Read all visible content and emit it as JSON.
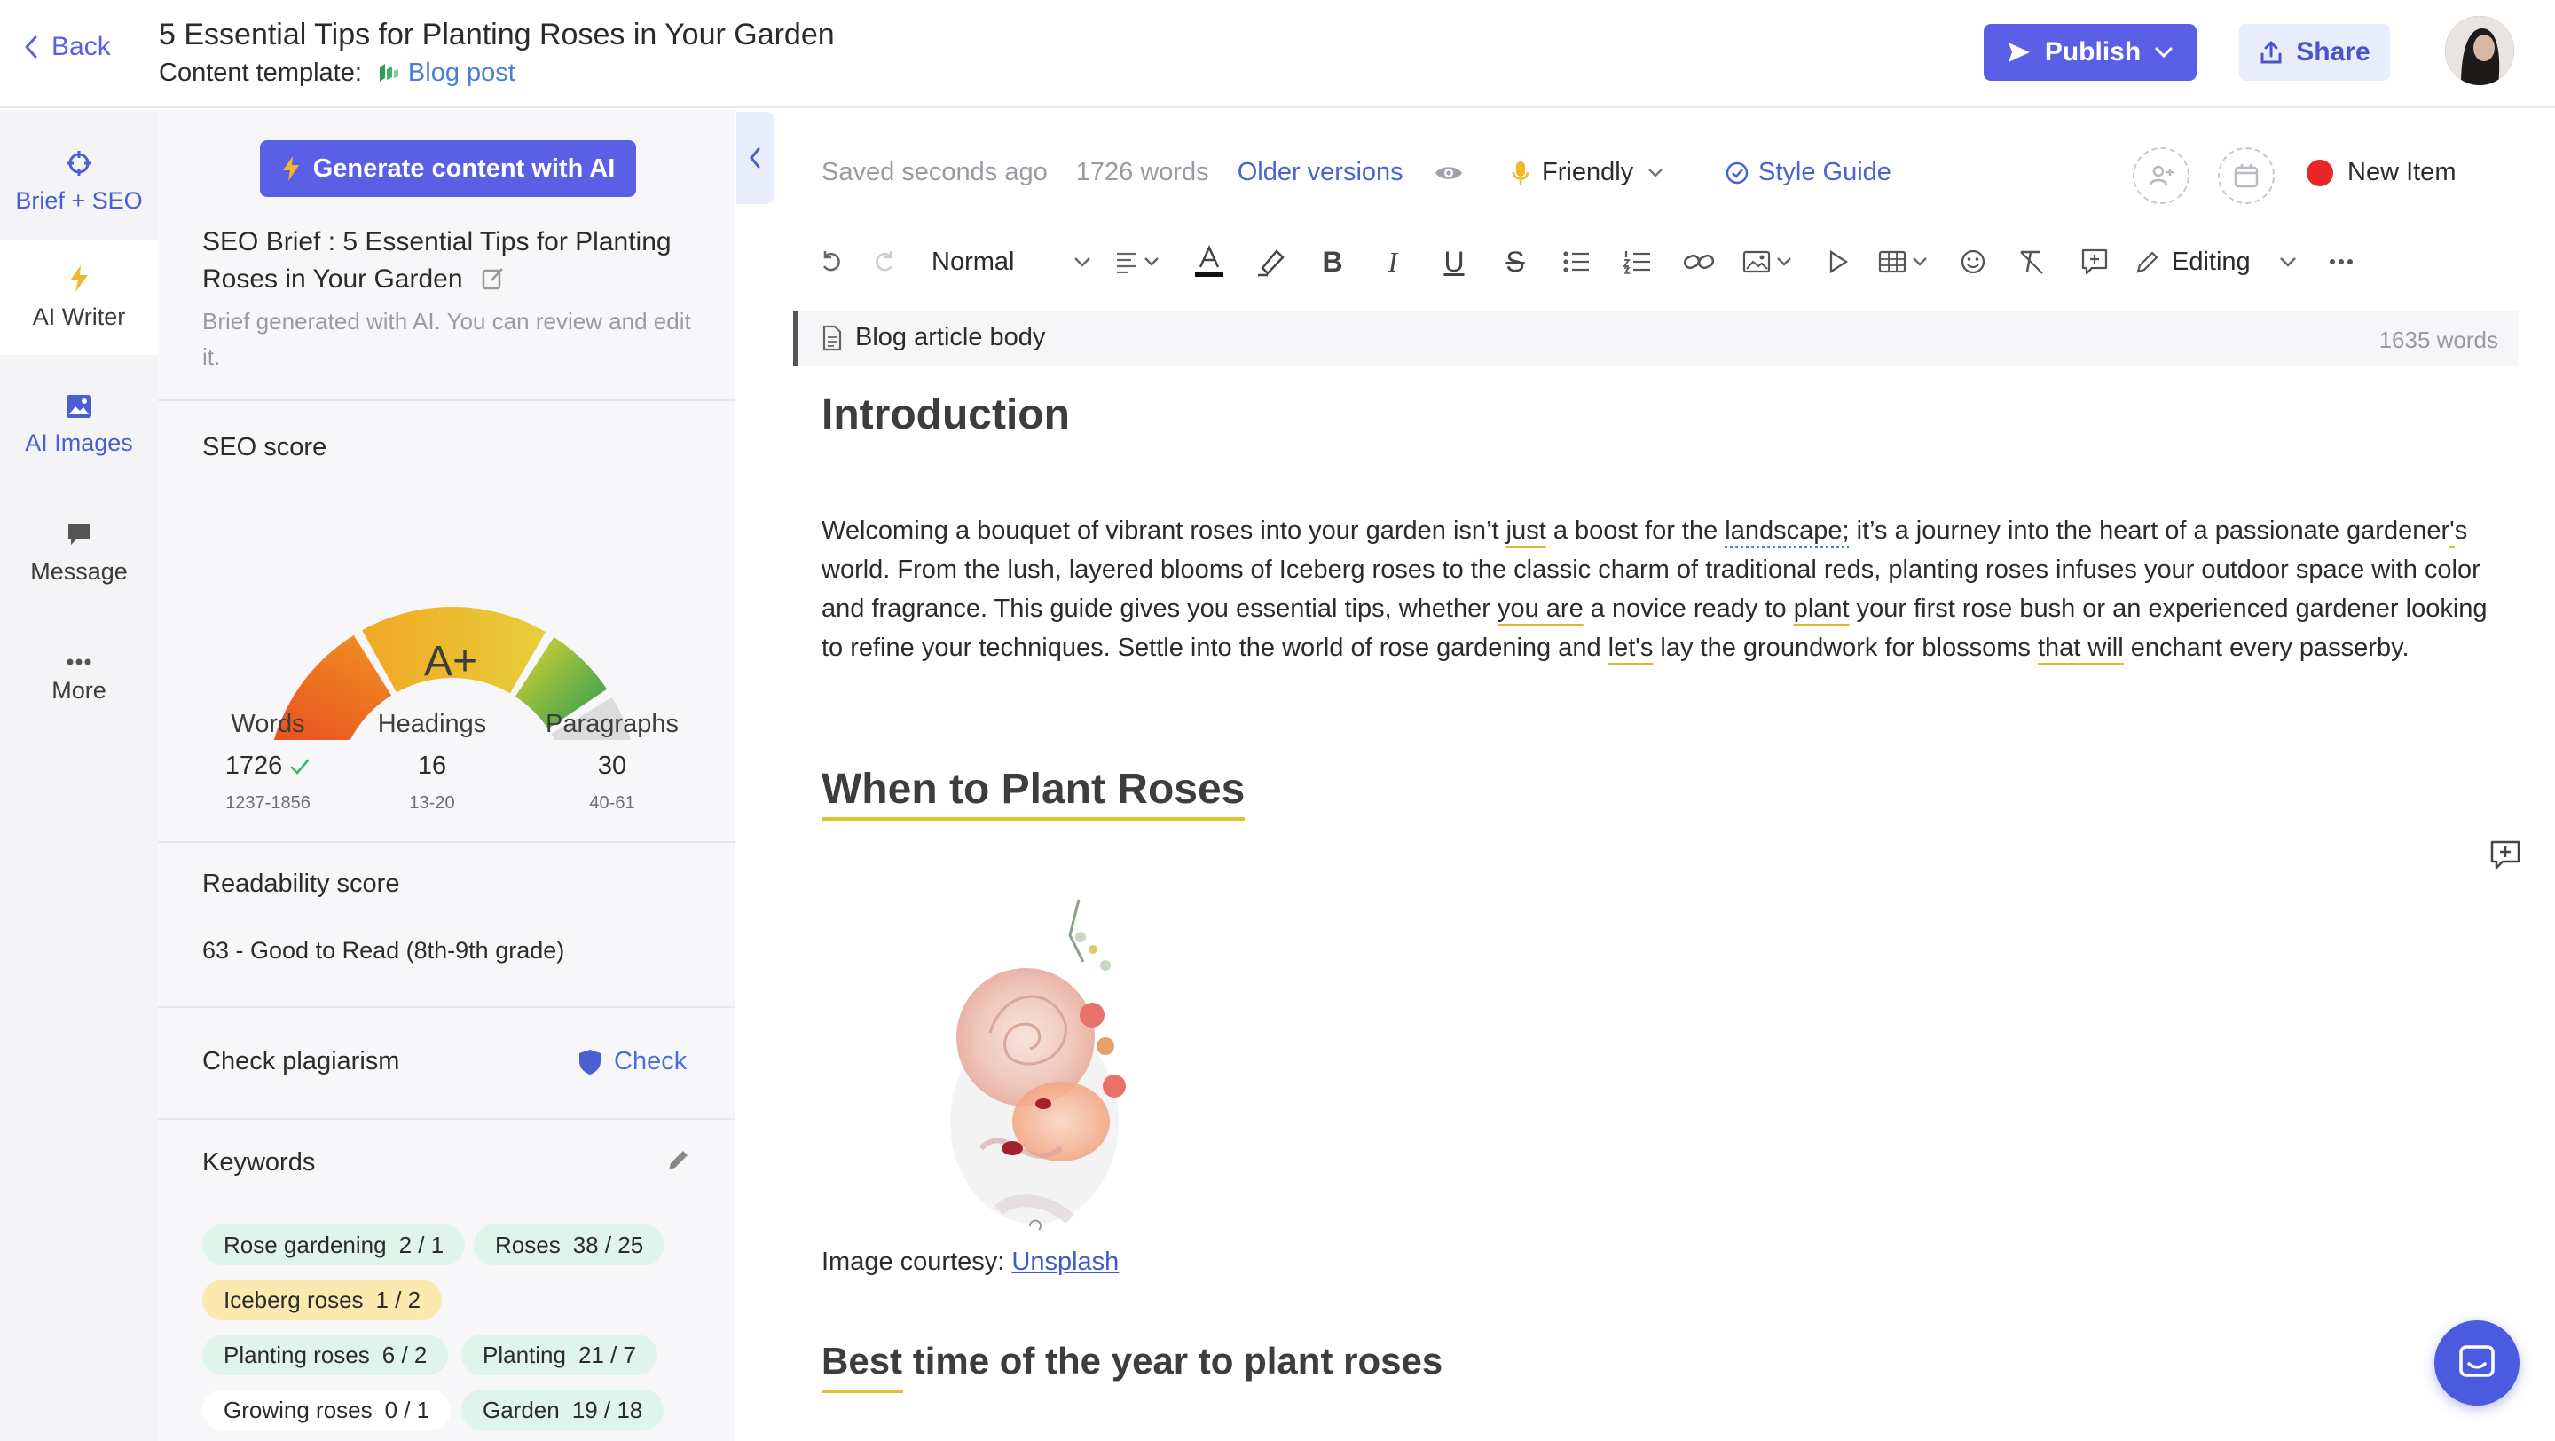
{
  "header": {
    "back_label": "Back",
    "title": "5 Essential Tips for Planting Roses in Your Garden",
    "template_label": "Content template:",
    "template_value": "Blog post",
    "publish_label": "Publish",
    "share_label": "Share"
  },
  "rail": {
    "items": [
      {
        "label": "Brief + SEO",
        "icon": "crosshair-icon"
      },
      {
        "label": "AI Writer",
        "icon": "lightning-icon"
      },
      {
        "label": "AI Images",
        "icon": "image-icon"
      },
      {
        "label": "Message",
        "icon": "chat-bubble-icon"
      },
      {
        "label": "More",
        "icon": "ellipsis-icon"
      }
    ]
  },
  "panel": {
    "generate_label": "Generate content with AI",
    "brief_title": "SEO Brief : 5 Essential Tips for Planting Roses in Your Garden",
    "brief_sub": "Brief generated with AI. You can review and edit it.",
    "seo_score_label": "SEO score",
    "grade": "A+",
    "stats": [
      {
        "label": "Words",
        "value": "1726",
        "range": "1237-1856",
        "ok": true
      },
      {
        "label": "Headings",
        "value": "16",
        "range": "13-20"
      },
      {
        "label": "Paragraphs",
        "value": "30",
        "range": "40-61"
      }
    ],
    "readability_label": "Readability score",
    "readability_value": "63 - Good to Read (8th-9th grade)",
    "plagiarism_label": "Check plagiarism",
    "check_label": "Check",
    "keywords_label": "Keywords",
    "keywords": [
      {
        "name": "Rose gardening",
        "count": "2 / 1",
        "color": "green"
      },
      {
        "name": "Roses",
        "count": "38 / 25",
        "color": "green"
      },
      {
        "name": "Iceberg roses",
        "count": "1 / 2",
        "color": "yellow"
      },
      {
        "name": "Planting roses",
        "count": "6 / 2",
        "color": "green"
      },
      {
        "name": "Planting",
        "count": "21 / 7",
        "color": "green"
      },
      {
        "name": "Growing roses",
        "count": "0 / 1",
        "color": "white"
      },
      {
        "name": "Garden",
        "count": "19 / 18",
        "color": "green"
      }
    ]
  },
  "editor": {
    "saved": "Saved seconds ago",
    "words": "1726 words",
    "older_versions": "Older versions",
    "tone": "Friendly",
    "style_guide": "Style Guide",
    "new_item": "New Item",
    "paragraph_style": "Normal",
    "mode": "Editing",
    "block_label": "Blog article body",
    "block_words": "1635 words",
    "h_intro": "Introduction",
    "intro_p1": "Welcoming a bouquet of vibrant roses into your garden isn’t ",
    "intro_just": "just",
    "intro_p2": " a boost for the ",
    "intro_landscape": "landscape;",
    "intro_p3": " it’s a journey into the heart of a passionate gardener",
    "intro_apos": "'",
    "intro_p4": "s world. From the lush, layered blooms of Iceberg roses to the classic charm of traditional reds, planting roses infuses your outdoor space with color and fragrance. This guide gives you essential tips, whether ",
    "intro_youare": "you are",
    "intro_p5": " a novice ready to ",
    "intro_plant": "plant",
    "intro_p6": " your first rose bush or an experienced gardener looking to refine your techniques. Settle into the world of rose gardening and ",
    "intro_lets": "let's",
    "intro_p7": " lay the groundwork for blossoms ",
    "intro_thatwill": "that will",
    "intro_p8": " enchant every passerby.",
    "h_when": "When to Plant Roses",
    "caption_prefix": "Image courtesy: ",
    "caption_link": "Unsplash",
    "h_best": "Best time of the year to plant roses",
    "accent_color": "#5b5fe6"
  }
}
